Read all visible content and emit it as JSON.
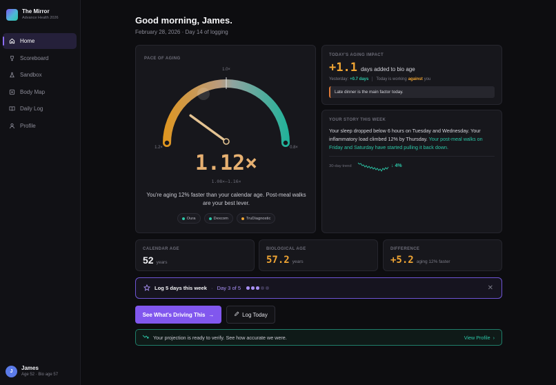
{
  "app": {
    "title": "The Mirror",
    "subtitle": "Advance Health 2026"
  },
  "sidebar": {
    "items": [
      {
        "label": "Home",
        "icon": "home-icon",
        "active": true
      },
      {
        "label": "Scoreboard",
        "icon": "trophy-icon",
        "active": false
      },
      {
        "label": "Sandbox",
        "icon": "flask-icon",
        "active": false
      },
      {
        "label": "Body Map",
        "icon": "body-map-icon",
        "active": false
      },
      {
        "label": "Daily Log",
        "icon": "book-icon",
        "active": false
      },
      {
        "label": "Profile",
        "icon": "user-icon",
        "active": false
      }
    ],
    "user": {
      "initial": "J",
      "name": "James",
      "meta": "Age 52 · Bio age 57"
    }
  },
  "header": {
    "greeting": "Good morning, James.",
    "date_line": "February 28, 2026 · Day 14 of logging"
  },
  "pace": {
    "label": "PACE OF AGING",
    "tick_top": "1.0×",
    "tick_left": "1.2×",
    "tick_right": "0.8×",
    "value": "1.12×",
    "gauge_value": 1.12,
    "gauge_min": 0.8,
    "gauge_max": 1.2,
    "range": "1.08×–1.16×",
    "description": "You're aging 12% faster than your calendar age. Post-meal walks are your best lever.",
    "sources": [
      {
        "name": "Oura",
        "color": "#2cc7a8"
      },
      {
        "name": "Dexcom",
        "color": "#2cc7a8"
      },
      {
        "name": "TruDiagnostic",
        "color": "#f0a534"
      }
    ]
  },
  "impact": {
    "label": "TODAY'S AGING IMPACT",
    "value": "+1.1",
    "unit": "days added to bio age",
    "yesterday_label": "Yesterday:",
    "yesterday_value": "+0.7 days",
    "today_prefix": "Today is working",
    "today_emphasis": "against",
    "today_suffix": "you",
    "note": "Late dinner is the main factor today."
  },
  "story": {
    "label": "YOUR STORY THIS WEEK",
    "text_plain": "Your sleep dropped below 6 hours on Tuesday and Wednesday. Your inflammatory load climbed 12% by Thursday.",
    "text_highlight": "Your post-meal walks on Friday and Saturday have started pulling it back down.",
    "trend_label": "30-day trend",
    "trend_change": "↓ 4%"
  },
  "stats": [
    {
      "label": "CALENDAR AGE",
      "value": "52",
      "unit": "years"
    },
    {
      "label": "BIOLOGICAL AGE",
      "value": "57.2",
      "unit": "years"
    },
    {
      "label": "DIFFERENCE",
      "value": "+5.2",
      "unit": "aging 12% faster"
    }
  ],
  "streak": {
    "title": "Log 5 days this week",
    "separator": "·",
    "progress": "Day 3 of 5",
    "done": 3,
    "total": 5
  },
  "actions": {
    "primary": "See What's Driving This",
    "secondary": "Log Today"
  },
  "projection": {
    "text": "Your projection is ready to verify. See how accurate we were.",
    "link": "View Profile"
  },
  "colors": {
    "accent": "#8157ee",
    "teal": "#2cc7a8",
    "amber": "#f0a534"
  }
}
